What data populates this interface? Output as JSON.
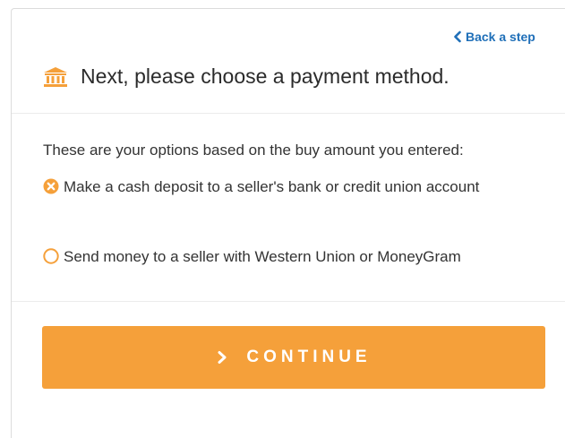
{
  "navigation": {
    "back_label": "Back a step"
  },
  "header": {
    "title": "Next, please choose a payment method.",
    "icon": "bank-icon"
  },
  "content": {
    "intro": "These are your options based on the buy amount you entered:",
    "options": [
      {
        "label": "Make a cash deposit to a seller's bank or credit union account",
        "state": "unavailable",
        "icon": "x-circle-icon"
      },
      {
        "label": "Send money to a seller with Western Union or MoneyGram",
        "state": "unselected",
        "icon": "radio-empty-icon"
      }
    ]
  },
  "actions": {
    "continue_label": "CONTINUE"
  },
  "colors": {
    "accent": "#f5a03a",
    "link": "#1f6fb8",
    "text": "#333333"
  }
}
